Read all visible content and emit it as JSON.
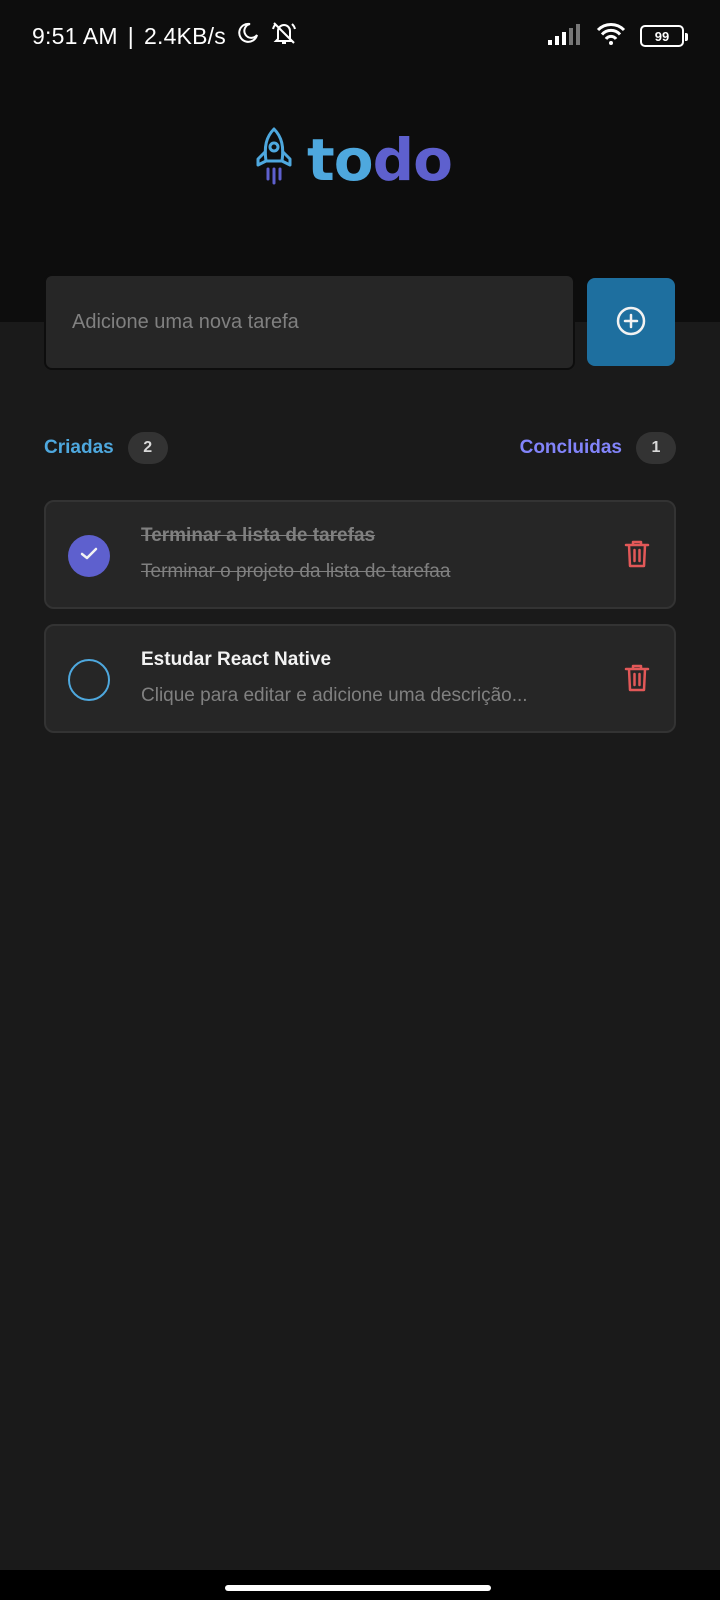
{
  "status_bar": {
    "time": "9:51 AM",
    "separator": "|",
    "net_speed": "2.4KB/s",
    "icons": [
      "moon-icon",
      "bell-off-icon",
      "signal-icon",
      "wifi-icon"
    ],
    "battery": "99"
  },
  "header": {
    "logo_icon": "rocket-icon",
    "logo_part1": "to",
    "logo_part2": "do"
  },
  "new_task": {
    "placeholder": "Adicione uma nova tarefa",
    "value": "",
    "add_icon": "plus-circle-icon"
  },
  "counters": {
    "created_label": "Criadas",
    "created_count": "2",
    "done_label": "Concluidas",
    "done_count": "1"
  },
  "tasks": [
    {
      "title": "Terminar a lista de tarefas",
      "description": "Terminar o projeto da lista de tarefaa",
      "done": true
    },
    {
      "title": "Estudar React Native",
      "description": "Clique para editar e adicione uma descrição...",
      "done": false
    }
  ],
  "colors": {
    "blue": "#4ea8de",
    "purple": "#5e60ce",
    "purple_light": "#8284fa",
    "blue_dark": "#1e6f9f",
    "danger": "#e25858",
    "bg": "#1a1a1a",
    "header_bg": "#0d0d0d",
    "card_bg": "#262626"
  }
}
